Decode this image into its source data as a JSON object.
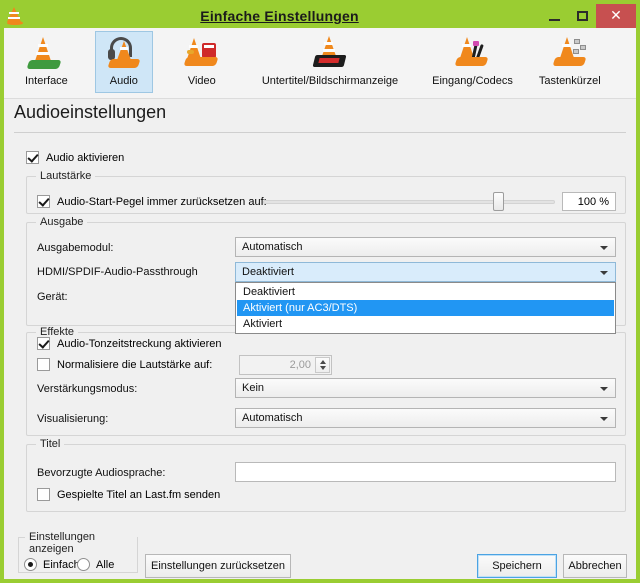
{
  "window": {
    "title": "Einfache Einstellungen",
    "app_icon": "vlc-cone-icon",
    "minimize_label": "_",
    "maximize_label": "□",
    "close_label": "✕",
    "titlebar_color": "#9acd32",
    "close_button_color": "#c75050"
  },
  "toolbar": {
    "items": [
      {
        "id": "interface",
        "label": "Interface",
        "icon": "vlc-cone-interface-icon",
        "selected": false
      },
      {
        "id": "audio",
        "label": "Audio",
        "icon": "vlc-cone-headphones-icon",
        "selected": true
      },
      {
        "id": "video",
        "label": "Video",
        "icon": "vlc-cone-video-icon",
        "selected": false
      },
      {
        "id": "subtitles",
        "label": "Untertitel/Bildschirmanzeige",
        "icon": "vlc-cone-subtitles-icon",
        "selected": false
      },
      {
        "id": "input",
        "label": "Eingang/Codecs",
        "icon": "vlc-cone-cables-icon",
        "selected": false
      },
      {
        "id": "hotkeys",
        "label": "Tastenkürzel",
        "icon": "vlc-cone-keyboard-icon",
        "selected": false
      }
    ],
    "selected_highlight_color": "#cfe6f7"
  },
  "page": {
    "heading": "Audioeinstellungen",
    "enable_audio": {
      "label": "Audio aktivieren",
      "checked": true
    }
  },
  "volume_group": {
    "title": "Lautstärke",
    "reset_level": {
      "label": "Audio-Start-Pegel immer zurücksetzen auf:",
      "checked": true
    },
    "slider_value": 100,
    "slider_min": 0,
    "slider_max": 125,
    "volume_display": "100 %"
  },
  "output_group": {
    "title": "Ausgabe",
    "output_module": {
      "label": "Ausgabemodul:",
      "value": "Automatisch"
    },
    "passthrough": {
      "label": "HDMI/SPDIF-Audio-Passthrough",
      "value": "Deaktiviert",
      "open": true,
      "options": [
        {
          "label": "Deaktiviert",
          "highlighted": false
        },
        {
          "label": "Aktiviert (nur AC3/DTS)",
          "highlighted": true
        },
        {
          "label": "Aktiviert",
          "highlighted": false
        }
      ],
      "highlight_color": "#2196f3"
    },
    "device": {
      "label": "Gerät:"
    }
  },
  "effects_group": {
    "title": "Effekte",
    "time_stretch": {
      "label": "Audio-Tonzeitstreckung aktivieren",
      "checked": true
    },
    "normalize": {
      "label": "Normalisiere die Lautstärke auf:",
      "checked": false,
      "value": "2,00"
    },
    "gain_mode": {
      "label": "Verstärkungsmodus:",
      "value": "Kein"
    },
    "visualization": {
      "label": "Visualisierung:",
      "value": "Automatisch"
    }
  },
  "tracks_group": {
    "title": "Titel",
    "preferred_language": {
      "label": "Bevorzugte Audiosprache:",
      "value": "",
      "placeholder": ""
    },
    "lastfm": {
      "label": "Gespielte Titel an Last.fm senden",
      "checked": false
    }
  },
  "footer": {
    "show_settings_group_title": "Einstellungen anzeigen",
    "radio_simple": {
      "label": "Einfach",
      "checked": true
    },
    "radio_all": {
      "label": "Alle",
      "checked": false
    },
    "reset_button": "Einstellungen zurücksetzen",
    "save_button": "Speichern",
    "cancel_button": "Abbrechen"
  }
}
